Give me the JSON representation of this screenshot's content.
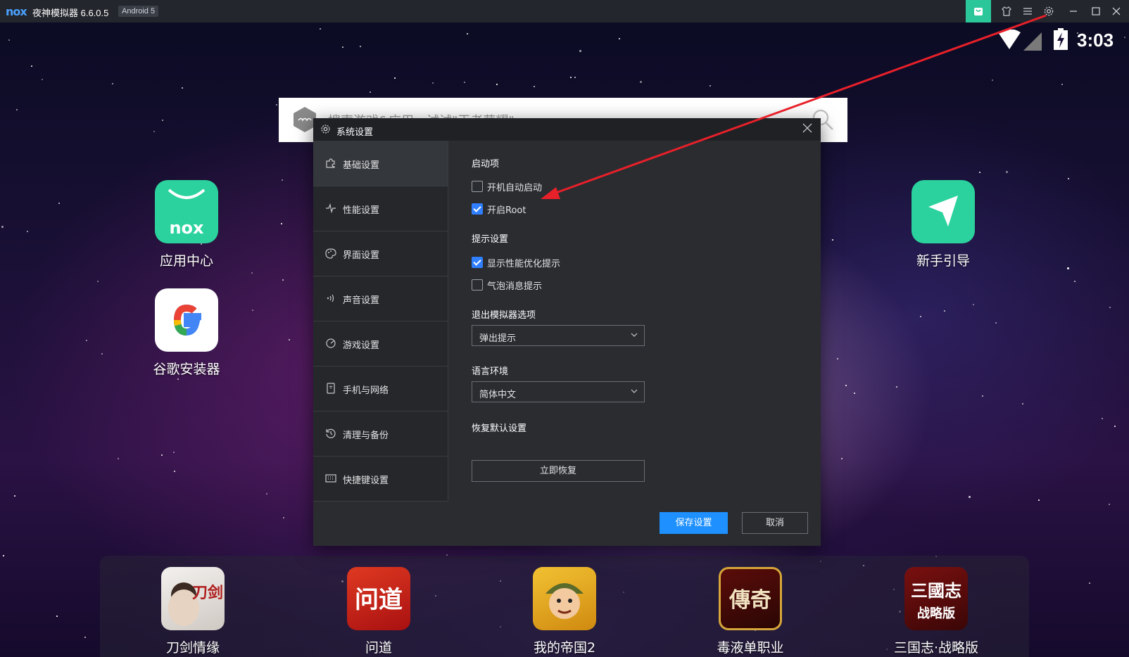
{
  "titlebar": {
    "logo_text": "nox",
    "title": "夜神模拟器 6.6.0.5",
    "android_badge": "Android 5"
  },
  "status_bar": {
    "time": "3:03"
  },
  "search": {
    "placeholder": "搜索游戏&应用，试试\"王者荣耀\""
  },
  "desktop_apps": [
    {
      "label": "应用中心",
      "icon": "nox-app-center-icon"
    },
    {
      "label": "谷歌安装器",
      "icon": "google-installer-icon"
    },
    {
      "label": "新手引导",
      "icon": "beginner-guide-icon"
    }
  ],
  "dock_apps": [
    {
      "label": "刀剑情缘"
    },
    {
      "label": "问道"
    },
    {
      "label": "我的帝国2"
    },
    {
      "label": "毒液单职业"
    },
    {
      "label": "三国志·战略版"
    }
  ],
  "dock_app_art": {
    "daojian": "刀剑",
    "wendao": "问道",
    "chuanqi": "傳奇",
    "sanguo_top": "三國志",
    "sanguo_bottom": "战略版"
  },
  "dialog": {
    "title": "系统设置",
    "nav": [
      {
        "label": "基础设置",
        "icon": "puzzle-icon",
        "active": true
      },
      {
        "label": "性能设置",
        "icon": "pulse-icon"
      },
      {
        "label": "界面设置",
        "icon": "palette-icon"
      },
      {
        "label": "声音设置",
        "icon": "sound-icon"
      },
      {
        "label": "游戏设置",
        "icon": "game-icon"
      },
      {
        "label": "手机与网络",
        "icon": "phone-icon"
      },
      {
        "label": "清理与备份",
        "icon": "history-icon"
      },
      {
        "label": "快捷键设置",
        "icon": "keyboard-icon"
      }
    ],
    "sections": {
      "startup": {
        "title": "启动项",
        "options": [
          {
            "label": "开机自动启动",
            "checked": false
          },
          {
            "label": "开启Root",
            "checked": true
          }
        ]
      },
      "tips": {
        "title": "提示设置",
        "options": [
          {
            "label": "显示性能优化提示",
            "checked": true
          },
          {
            "label": "气泡消息提示",
            "checked": false
          }
        ]
      },
      "exit": {
        "title": "退出模拟器选项",
        "value": "弹出提示"
      },
      "language": {
        "title": "语言环境",
        "value": "简体中文"
      },
      "restore": {
        "title": "恢复默认设置",
        "button": "立即恢复"
      }
    },
    "save_button": "保存设置",
    "cancel_button": "取消"
  },
  "colors": {
    "accent": "#1e90ff",
    "shop_button": "#2bc79b",
    "annotation_arrow": "#e8202a"
  }
}
